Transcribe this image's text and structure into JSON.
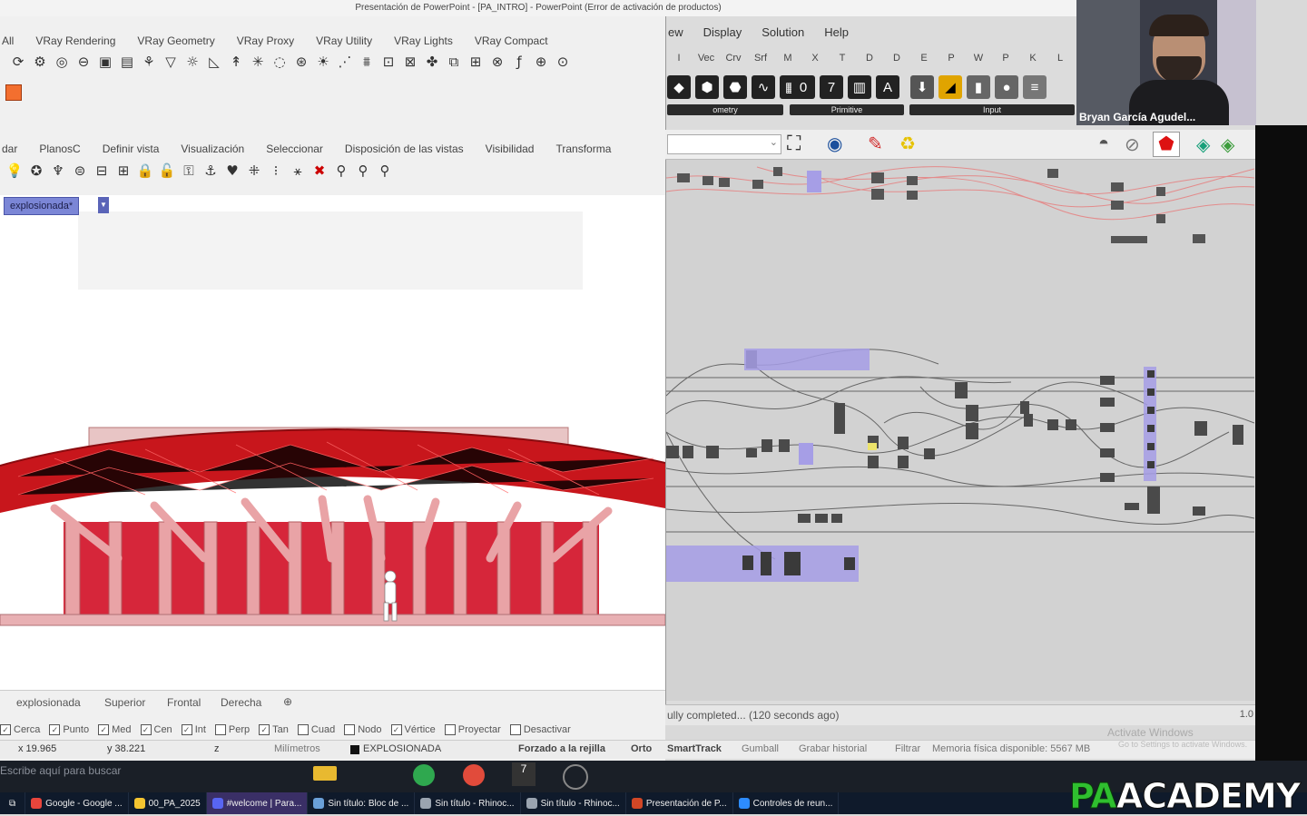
{
  "window_title": "Presentación de PowerPoint - [PA_INTRO] - PowerPoint (Error de activación de productos)",
  "rhino": {
    "ribbon_tabs": [
      "All",
      "VRay Rendering",
      "VRay Geometry",
      "VRay Proxy",
      "VRay Utility",
      "VRay Lights",
      "VRay Compact"
    ],
    "ribbon_tabs2": [
      "dar",
      "PlanosC",
      "Definir vista",
      "Visualización",
      "Seleccionar",
      "Disposición de las vistas",
      "Visibilidad",
      "Transforma"
    ],
    "viewport_name": "explosionada*",
    "view_tabs": [
      "explosionada",
      "Superior",
      "Frontal",
      "Derecha"
    ],
    "osnaps": [
      {
        "label": "Cerca",
        "checked": true
      },
      {
        "label": "Punto",
        "checked": true
      },
      {
        "label": "Med",
        "checked": true
      },
      {
        "label": "Cen",
        "checked": true
      },
      {
        "label": "Int",
        "checked": true
      },
      {
        "label": "Perp",
        "checked": false
      },
      {
        "label": "Tan",
        "checked": true
      },
      {
        "label": "Cuad",
        "checked": false
      },
      {
        "label": "Nodo",
        "checked": false
      },
      {
        "label": "Vértice",
        "checked": true
      },
      {
        "label": "Proyectar",
        "checked": false
      },
      {
        "label": "Desactivar",
        "checked": false
      }
    ],
    "status": {
      "x": "x 19.965",
      "y": "y 38.221",
      "z": "z",
      "units": "Milímetros",
      "layer": "EXPLOSIONADA",
      "grid_snap": "Forzado a la rejilla",
      "ortho": "Orto",
      "smarttrack": "SmartTrack",
      "gumball": "Gumball",
      "history": "Grabar historial",
      "filter": "Filtrar",
      "memory": "Memoria física disponible: 5567 MB"
    }
  },
  "grasshopper": {
    "menu": [
      "ew",
      "Display",
      "Solution",
      "Help"
    ],
    "component_tabs": [
      "I",
      "Vec",
      "Crv",
      "Srf",
      "M",
      "X",
      "T",
      "D",
      "D",
      "E",
      "P",
      "W",
      "P",
      "K",
      "L"
    ],
    "groups": [
      "ometry",
      "Primitive",
      "Input"
    ],
    "status_text": "ully completed... (120 seconds ago)",
    "zoom": "1.0"
  },
  "webcam": {
    "name": "Bryan García Agudel..."
  },
  "windows_activation": {
    "line1": "Activate Windows",
    "line2": "Go to Settings to activate Windows."
  },
  "search_hint": "Escribe aquí para buscar",
  "taskbar": [
    {
      "label": "Google - Google ...",
      "color": "#e8453c"
    },
    {
      "label": "00_PA_2025",
      "color": "#f4c430"
    },
    {
      "label": "#welcome | Para...",
      "color": "#5865f2"
    },
    {
      "label": "Sin título: Bloc de ...",
      "color": "#6aa0d8"
    },
    {
      "label": "Sin título - Rhinoc...",
      "color": "#9aa4b0"
    },
    {
      "label": "Sin título - Rhinoc...",
      "color": "#9aa4b0"
    },
    {
      "label": "Presentación de P...",
      "color": "#d24726"
    },
    {
      "label": "Controles de reun...",
      "color": "#2d8cff"
    }
  ],
  "brand": {
    "pa": "PA",
    "rest": "ACADEMY",
    "pa_color": "#2fbf2f",
    "rest_color": "#ffffff"
  }
}
